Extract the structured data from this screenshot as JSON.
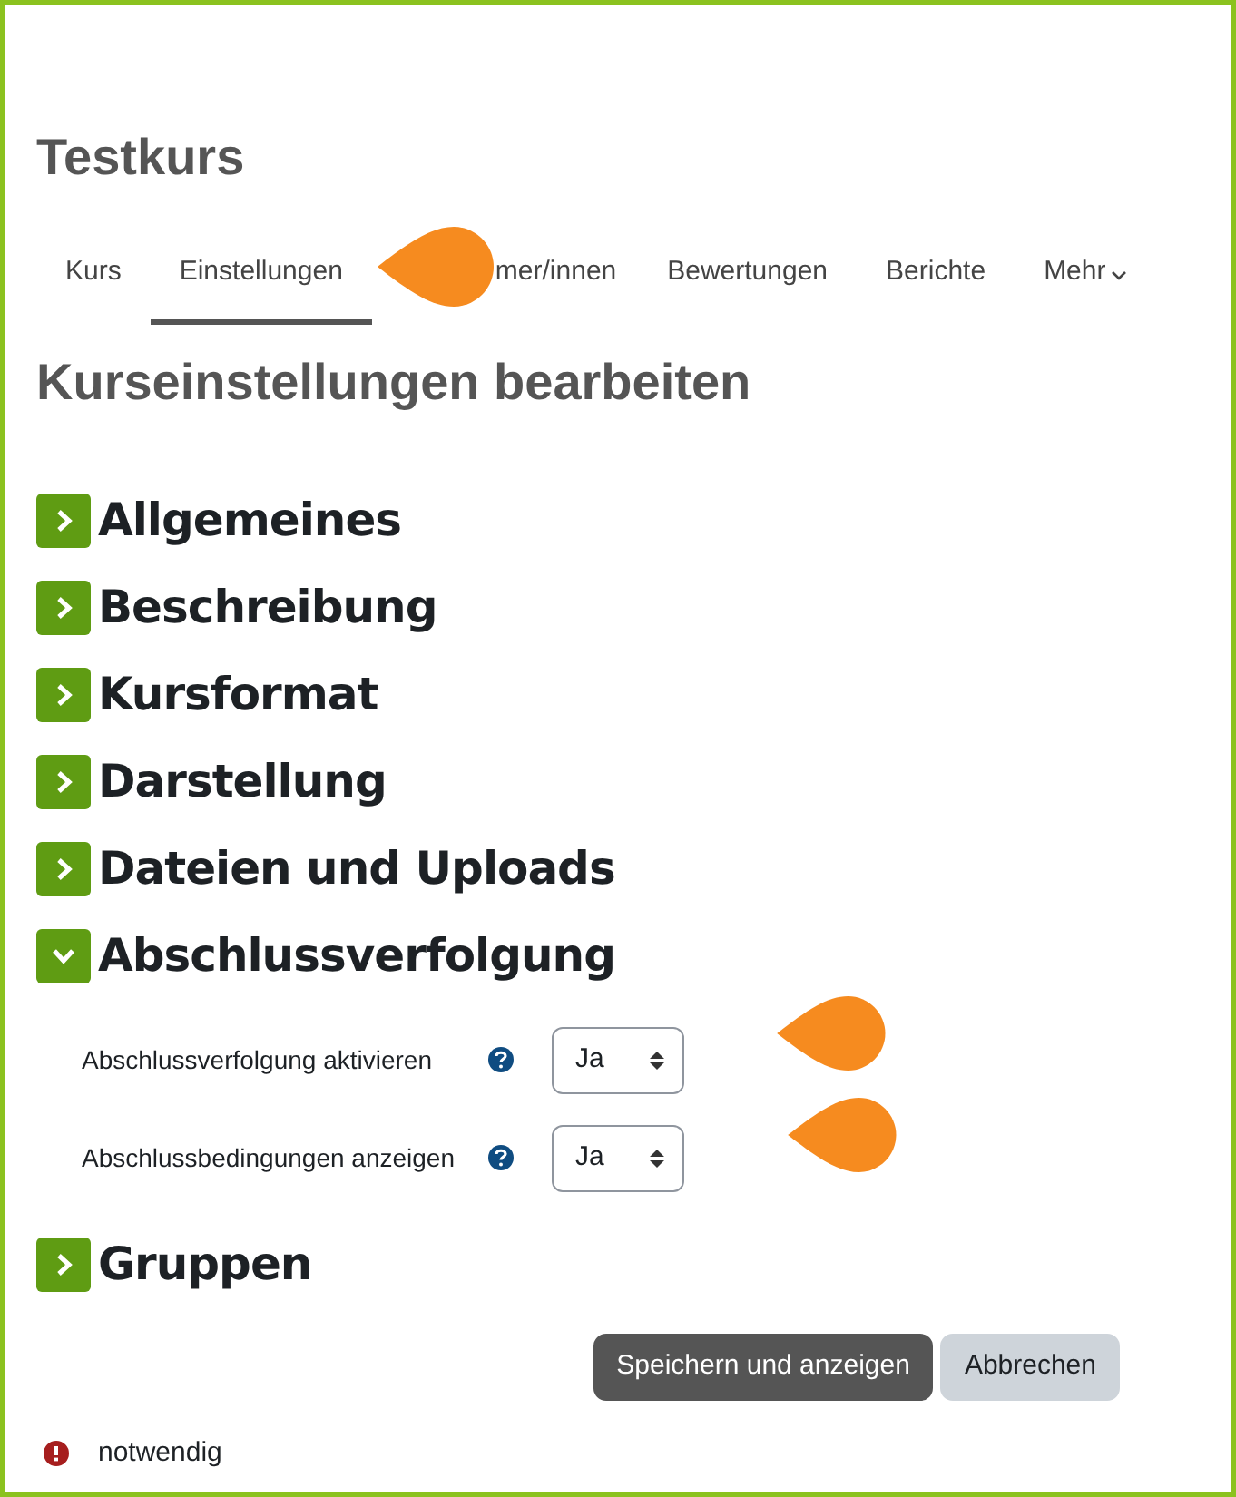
{
  "course_title": "Testkurs",
  "tabs": [
    {
      "label": "Kurs",
      "selected": false
    },
    {
      "label": "Einstellungen",
      "selected": true
    },
    {
      "label": "mer/innen",
      "selected": false
    },
    {
      "label": "Bewertungen",
      "selected": false
    },
    {
      "label": "Berichte",
      "selected": false
    },
    {
      "label": "Mehr",
      "selected": false,
      "dropdown": true
    }
  ],
  "heading": "Kurseinstellungen bearbeiten",
  "sections": [
    {
      "title": "Allgemeines",
      "expanded": false
    },
    {
      "title": "Beschreibung",
      "expanded": false
    },
    {
      "title": "Kursformat",
      "expanded": false
    },
    {
      "title": "Darstellung",
      "expanded": false
    },
    {
      "title": "Dateien und Uploads",
      "expanded": false
    },
    {
      "title": "Abschlussverfolgung",
      "expanded": true,
      "fields": [
        {
          "label": "Abschlussverfolgung aktivieren",
          "value": "Ja"
        },
        {
          "label": "Abschlussbedingungen anzeigen",
          "value": "Ja"
        }
      ]
    },
    {
      "title": "Gruppen",
      "expanded": false
    }
  ],
  "buttons": [
    {
      "label": "Speichern und anzeigen",
      "kind": "primary"
    },
    {
      "label": "Abbrechen",
      "kind": "secondary"
    }
  ],
  "required_note": "notwendig"
}
